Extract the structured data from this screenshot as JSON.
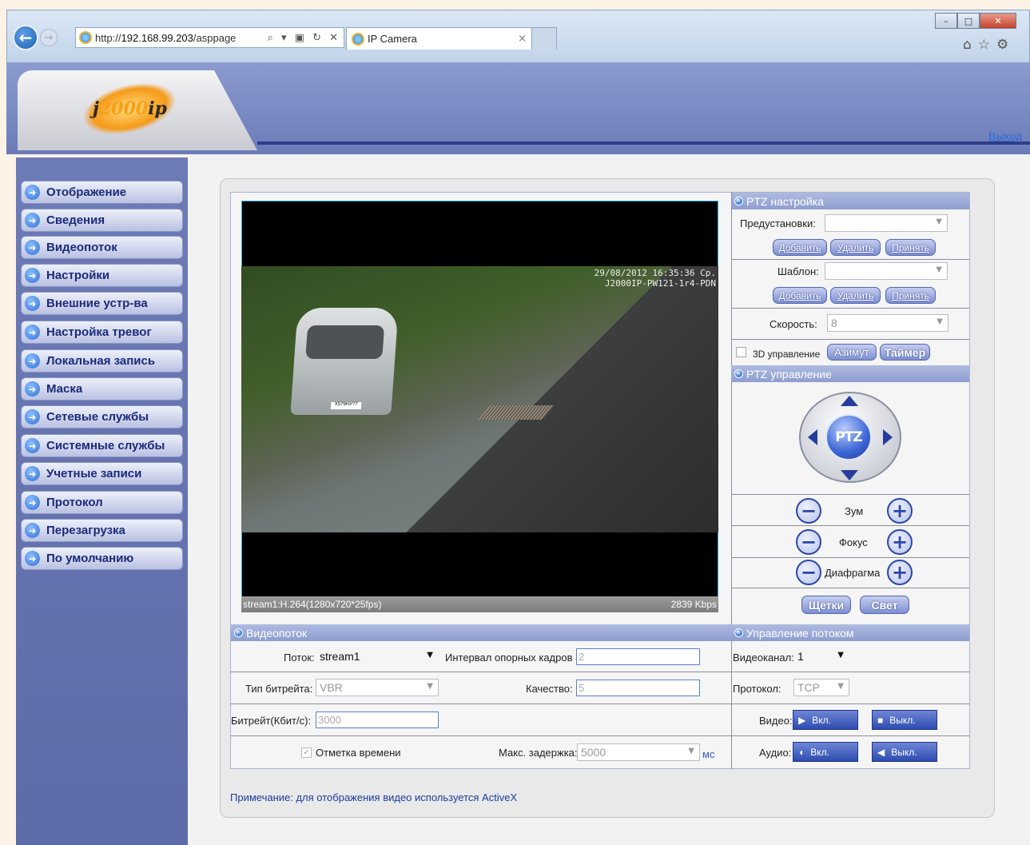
{
  "browser": {
    "url_prefix": "http://",
    "url_host": "192.168.99.203",
    "url_rest": "/asppage",
    "addr_tools": "⌕ ▾ ▣ ↻ ✕",
    "tab_title": "IP Camera",
    "tab_close": "×",
    "back_icon": "←",
    "forward_icon": "→",
    "win_min": "–",
    "win_max": "□",
    "win_close": "✕",
    "home_icon": "⌂",
    "star_icon": "☆",
    "gear_icon": "⚙"
  },
  "header": {
    "logo_j": "j",
    "logo_digits": "2000",
    "logo_ip": "ip",
    "logout": "Выход"
  },
  "sidebar": {
    "arrow_glyph": "➜",
    "items": [
      {
        "label": "Отображение"
      },
      {
        "label": "Сведения"
      },
      {
        "label": "Видеопоток"
      },
      {
        "label": "Настройки"
      },
      {
        "label": "Внешние устр-ва"
      },
      {
        "label": "Настройка тревог"
      },
      {
        "label": "Локальная запись"
      },
      {
        "label": "Маска"
      },
      {
        "label": "Сетевые службы"
      },
      {
        "label": "Системные службы"
      },
      {
        "label": "Учетные записи"
      },
      {
        "label": "Протокол"
      },
      {
        "label": "Перезагрузка"
      },
      {
        "label": "По умолчанию"
      }
    ]
  },
  "video": {
    "osd_line1": "29/08/2012 16:35:36 Ср.",
    "osd_line2": "J2000IP-PW121-1r4-PDN",
    "plate": "Х579НУ77",
    "stream_info": "stream1:H.264(1280x720*25fps)",
    "bitrate_info": "2839 Kbps"
  },
  "ptz_setup": {
    "title": "PTZ настройка",
    "presets_label": "Предустановки:",
    "presets_value": "",
    "add": "Добавить",
    "delete": "Удалить",
    "apply": "Принять",
    "template_label": "Шаблон:",
    "template_value": "",
    "speed_label": "Скорость:",
    "speed_value": "8",
    "control_3d": "3D управление",
    "azimuth": "Азимут",
    "timer": "Таймер"
  },
  "ptz_control": {
    "title": "PTZ управление",
    "center": "PTZ",
    "zoom": "Зум",
    "focus": "Фокус",
    "iris": "Диафрагма",
    "brushes": "Щетки",
    "light": "Свет",
    "minus": "−",
    "plus": "+"
  },
  "videostream": {
    "title": "Видеопоток",
    "stream_label": "Поток:",
    "stream_value": "stream1",
    "keyframe_label": "Интервал опорных кадров",
    "keyframe_value": "2",
    "bitrate_type_label": "Тип битрейта:",
    "bitrate_type_value": "VBR",
    "quality_label": "Качество:",
    "quality_value": "5",
    "bitrate_label": "Битрейт(Кбит/с):",
    "bitrate_value": "3000",
    "timestamp_label": "Отметка времени",
    "timestamp_checked": true,
    "max_delay_label": "Макс. задержка:",
    "max_delay_value": "5000",
    "max_delay_unit": "мс"
  },
  "stream_control": {
    "title": "Управление потоком",
    "channel_label": "Видеоканал:",
    "channel_value": "1",
    "protocol_label": "Протокол:",
    "protocol_value": "TCP",
    "video_label": "Видео:",
    "audio_label": "Аудио:",
    "on": "Вкл.",
    "off": "Выкл."
  },
  "note": "Примечание: для отображения видео используется ActiveX"
}
